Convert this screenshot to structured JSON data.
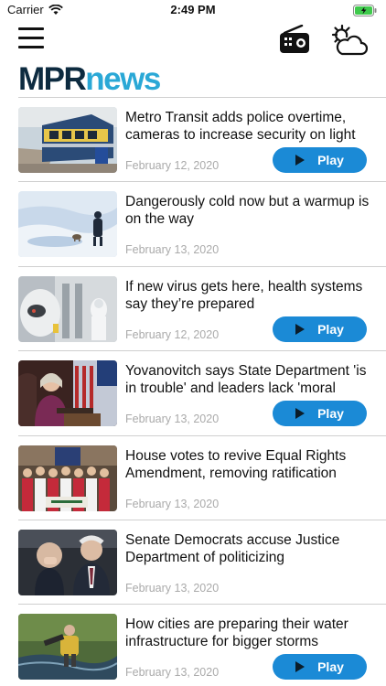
{
  "status_bar": {
    "carrier": "Carrier",
    "time": "2:49 PM"
  },
  "header": {
    "menu_icon": "hamburger-menu-icon",
    "radio_icon": "radio-icon",
    "weather_icon": "weather-icon"
  },
  "logo": {
    "part1": "MPR",
    "part2": "news"
  },
  "colors": {
    "brand_dark": "#0d2b40",
    "brand_blue": "#2aa8d6",
    "play_button": "#1b8ad6",
    "date_text": "#aaaaaa"
  },
  "stories": [
    {
      "headline": "Metro Transit adds police overtime, cameras to increase security on light",
      "date": "February 12, 2020",
      "play_label": "Play",
      "has_play": true
    },
    {
      "headline": "Dangerously cold now but a warmup is on the way",
      "date": "February 13, 2020",
      "play_label": "",
      "has_play": false
    },
    {
      "headline": "If new virus gets here, health systems say they’re prepared",
      "date": "February 12, 2020",
      "play_label": "Play",
      "has_play": true
    },
    {
      "headline": "Yovanovitch says State Department 'is in trouble' and leaders lack 'moral",
      "date": "February 13, 2020",
      "play_label": "Play",
      "has_play": true
    },
    {
      "headline": "House votes to revive Equal Rights Amendment, removing ratification",
      "date": "February 13, 2020",
      "play_label": "",
      "has_play": false
    },
    {
      "headline": "Senate Democrats accuse Justice Department of politicizing",
      "date": "February 13, 2020",
      "play_label": "",
      "has_play": false
    },
    {
      "headline": "How cities are preparing their water infrastructure for bigger storms",
      "date": "February 13, 2020",
      "play_label": "Play",
      "has_play": true
    }
  ]
}
